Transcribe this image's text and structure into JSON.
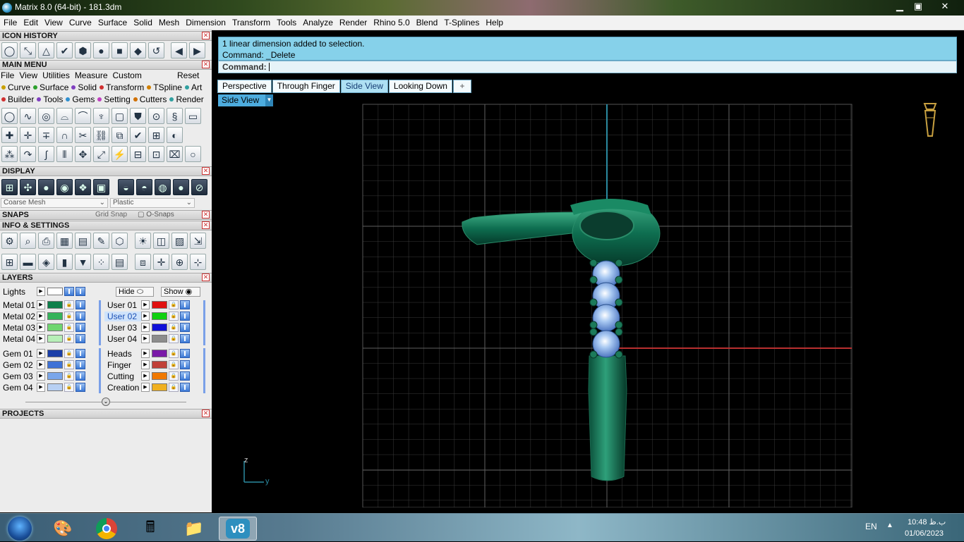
{
  "window": {
    "title": "Matrix 8.0 (64-bit) - 181.3dm",
    "minimize": "▁",
    "restore": "▣",
    "close": "✕"
  },
  "menubar": [
    "File",
    "Edit",
    "View",
    "Curve",
    "Surface",
    "Solid",
    "Mesh",
    "Dimension",
    "Transform",
    "Tools",
    "Analyze",
    "Render",
    "Rhino 5.0",
    "Blend",
    "T-Splines",
    "Help"
  ],
  "panels": {
    "icon_history": "ICON HISTORY",
    "main_menu": "MAIN MENU",
    "display": "DISPLAY",
    "snaps": "SNAPS",
    "info_settings": "INFO & SETTINGS",
    "layers": "LAYERS",
    "projects": "PROJECTS"
  },
  "main_menu": {
    "items": [
      "File",
      "View",
      "Utilities",
      "Measure",
      "Custom"
    ],
    "reset": "Reset",
    "row1": [
      {
        "label": "Curve",
        "color": "#c8a000"
      },
      {
        "label": "Surface",
        "color": "#2da02d"
      },
      {
        "label": "Solid",
        "color": "#8040c0"
      },
      {
        "label": "Transform",
        "color": "#d03030"
      },
      {
        "label": "TSpline",
        "color": "#d08000"
      },
      {
        "label": "Art",
        "color": "#30a0a0"
      }
    ],
    "row2": [
      {
        "label": "Builder",
        "color": "#d03030"
      },
      {
        "label": "Tools",
        "color": "#8040c0"
      },
      {
        "label": "Gems",
        "color": "#3090d0"
      },
      {
        "label": "Setting",
        "color": "#c040c0"
      },
      {
        "label": "Cutters",
        "color": "#d07000"
      },
      {
        "label": "Render",
        "color": "#30a0a0"
      }
    ]
  },
  "display": {
    "mesh": "Coarse Mesh",
    "material": "Plastic"
  },
  "snaps": {
    "grid": "Grid Snap",
    "osnaps": "O-Snaps"
  },
  "layers": {
    "lights": "Lights",
    "hide": "Hide",
    "show": "Show",
    "metal": [
      {
        "name": "Metal 01",
        "color": "#0f7f4a"
      },
      {
        "name": "Metal 02",
        "color": "#35b35a"
      },
      {
        "name": "Metal 03",
        "color": "#6fd66f"
      },
      {
        "name": "Metal 04",
        "color": "#b7efb7"
      }
    ],
    "gem": [
      {
        "name": "Gem 01",
        "color": "#1a3ea8"
      },
      {
        "name": "Gem 02",
        "color": "#3f72d6"
      },
      {
        "name": "Gem 03",
        "color": "#7aa6ea"
      },
      {
        "name": "Gem 04",
        "color": "#b8d0f3"
      }
    ],
    "user": [
      {
        "name": "User 01",
        "color": "#e01010"
      },
      {
        "name": "User 02",
        "color": "#10d010"
      },
      {
        "name": "User 03",
        "color": "#1010d8"
      },
      {
        "name": "User 04",
        "color": "#8c8c8c"
      }
    ],
    "misc": [
      {
        "name": "Heads",
        "color": "#7a1aa8"
      },
      {
        "name": "Finger",
        "color": "#c04038"
      },
      {
        "name": "Cutting",
        "color": "#f07800"
      },
      {
        "name": "Creation",
        "color": "#f0b020"
      }
    ]
  },
  "command": {
    "history": [
      "1 linear dimension added to selection.",
      "Command: _Delete"
    ],
    "prompt": "Command:"
  },
  "tabs": [
    "Perspective",
    "Through Finger",
    "Side View",
    "Looking Down",
    "+"
  ],
  "viewport": {
    "label": "Side View",
    "axis_z": "z",
    "axis_y": "y"
  },
  "taskbar": {
    "lang": "EN",
    "time": "10:48 ب.ظ",
    "date": "01/06/2023"
  }
}
